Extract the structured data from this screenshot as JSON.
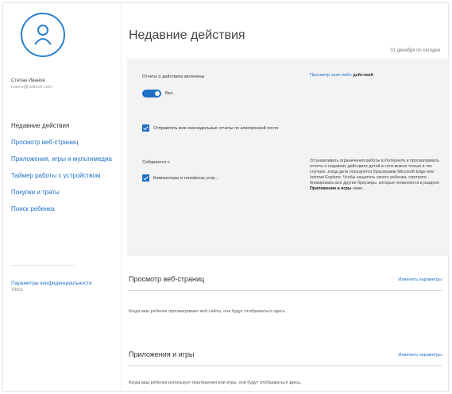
{
  "sidebar": {
    "user_name": "Степан Иванов",
    "user_email": "ivanov@outlook.com",
    "nav": [
      {
        "label": "Недавние действия",
        "active": true
      },
      {
        "label": "Просмотр веб-страниц",
        "active": false
      },
      {
        "label": "Приложения, игры и мультимедиа",
        "active": false
      },
      {
        "label": "Таймер работы с устройством",
        "active": false
      },
      {
        "label": "Покупки и траты",
        "active": false
      },
      {
        "label": "Поиск ребенка",
        "active": false
      }
    ],
    "privacy_label": "Параметры конфиденциальности",
    "privacy_brand": "Xbox"
  },
  "main": {
    "title": "Недавние действия",
    "date": "31 декабря по сегодня",
    "panel": {
      "reports_label": "Отчеты о действиях включены",
      "toggle_state": "Вкл.",
      "link_text": "Просмотр чьих-либо",
      "link_bold": "действий",
      "email_option": "Отправлять мне еженедельные отчеты по электронной почте",
      "collect_label": "Собирается с",
      "device_option": "Компьютеры и телефоны устр...",
      "info_text": "Устанавливать ограничения работы в Интернете и просматривать отчеты о недавних действиях детей в сети можно только в тех случаях, когда дети пользуются браузерами Microsoft Edge или Internet Explorer. Чтобы защитить своего ребенка, смотрите блокировать все другие браузеры, которые появляются в разделе",
      "info_bold": "Приложения и игры",
      "info_tail": "ниже."
    },
    "sections": [
      {
        "title": "Просмотр веб-страниц",
        "link": "Изменить параметры",
        "text": "Когда ваш ребенок просматривает веб-сайты, они будут отображаться здесь."
      },
      {
        "title": "Приложения и игры",
        "link": "Изменить параметры",
        "text": "Когда ваш ребенок использует приложения или игры, они будут отображаться здесь."
      }
    ]
  },
  "colors": {
    "accent": "#1f6fc4",
    "panel_bg": "#f3f3f3"
  }
}
